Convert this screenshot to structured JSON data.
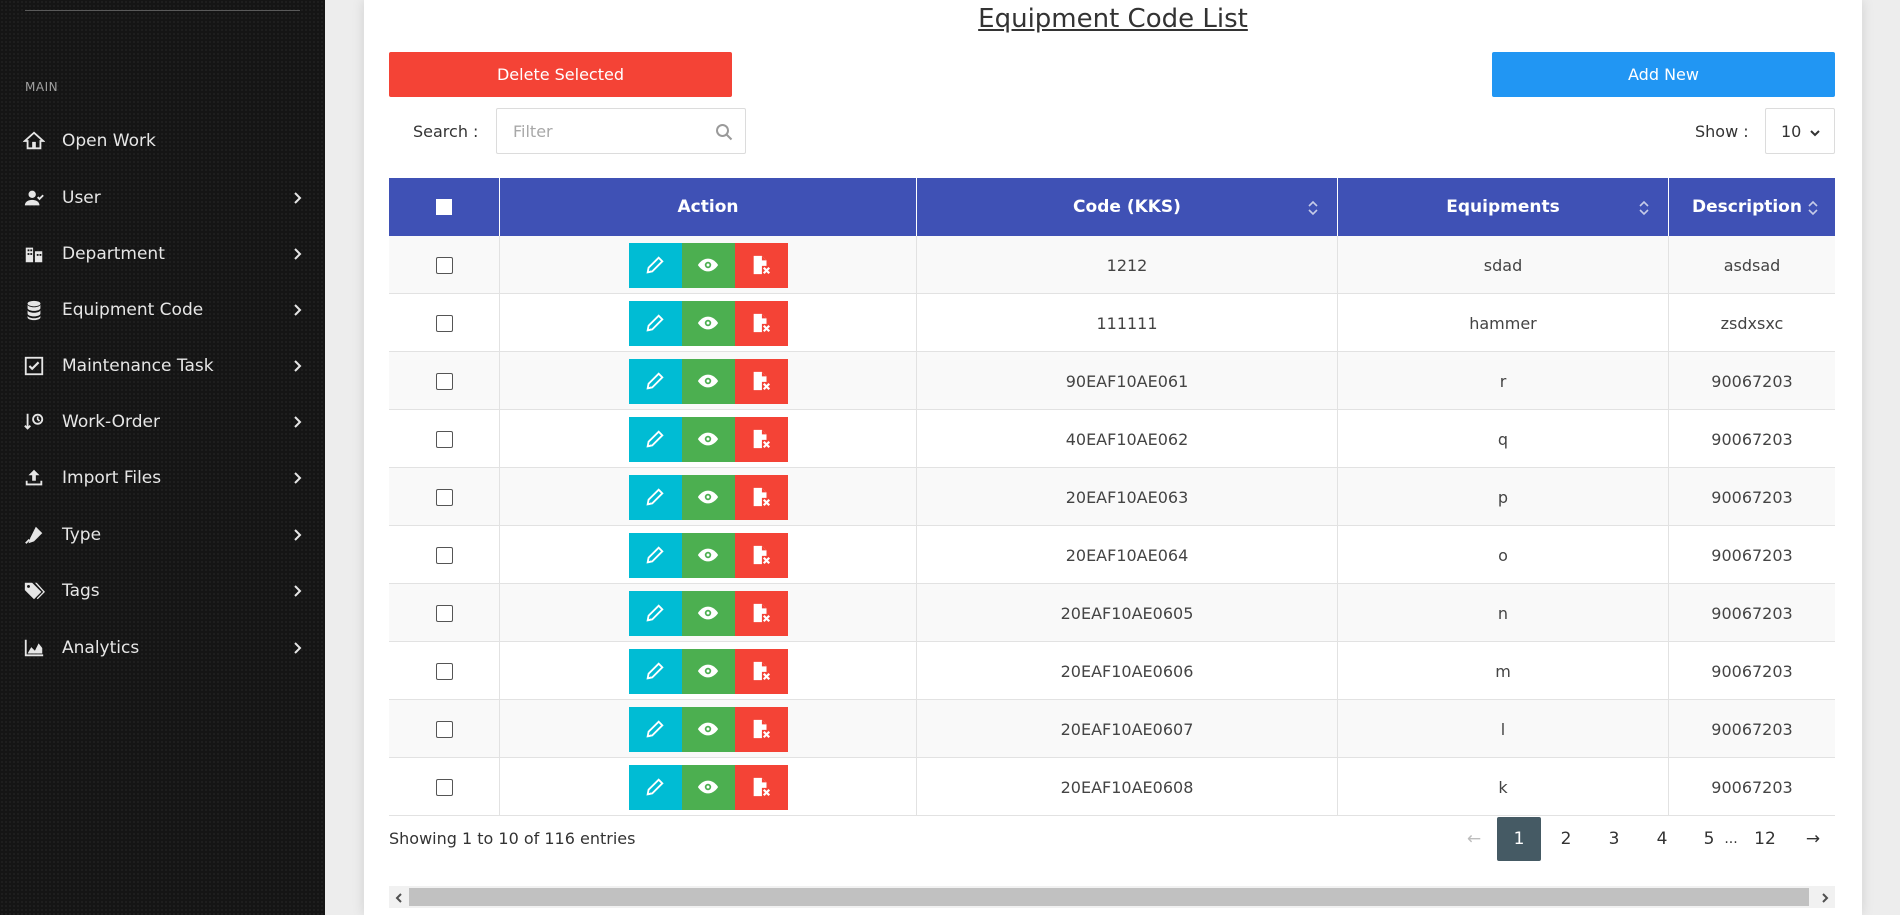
{
  "sidebar": {
    "section_label": "MAIN",
    "items": [
      {
        "label": "Open Work",
        "icon": "home-icon",
        "has_submenu": false
      },
      {
        "label": "User",
        "icon": "user-icon",
        "has_submenu": true
      },
      {
        "label": "Department",
        "icon": "building-icon",
        "has_submenu": true
      },
      {
        "label": "Equipment Code",
        "icon": "database-icon",
        "has_submenu": true
      },
      {
        "label": "Maintenance Task",
        "icon": "checkbox-icon",
        "has_submenu": true
      },
      {
        "label": "Work-Order",
        "icon": "sort-clock-icon",
        "has_submenu": true
      },
      {
        "label": "Import Files",
        "icon": "upload-icon",
        "has_submenu": true
      },
      {
        "label": "Type",
        "icon": "pen-icon",
        "has_submenu": true
      },
      {
        "label": "Tags",
        "icon": "tags-icon",
        "has_submenu": true
      },
      {
        "label": "Analytics",
        "icon": "chart-area-icon",
        "has_submenu": true
      }
    ]
  },
  "page": {
    "title": "Equipment Code List",
    "delete_selected_label": "Delete Selected",
    "add_new_label": "Add New",
    "search_label": "Search :",
    "search_placeholder": "Filter",
    "search_value": "",
    "show_label": "Show :",
    "show_value": "10"
  },
  "table": {
    "columns": [
      "Action",
      "Code (KKS)",
      "Equipments",
      "Description"
    ],
    "sortable_columns": [
      "Code (KKS)",
      "Equipments",
      "Description"
    ],
    "rows": [
      {
        "code": "1212",
        "equipment": "sdad",
        "description": "asdsad"
      },
      {
        "code": "111111",
        "equipment": "hammer",
        "description": "zsdxsxc"
      },
      {
        "code": "90EAF10AE061",
        "equipment": "r",
        "description": "90067203"
      },
      {
        "code": "40EAF10AE062",
        "equipment": "q",
        "description": "90067203"
      },
      {
        "code": "20EAF10AE063",
        "equipment": "p",
        "description": "90067203"
      },
      {
        "code": "20EAF10AE064",
        "equipment": "o",
        "description": "90067203"
      },
      {
        "code": "20EAF10AE0605",
        "equipment": "n",
        "description": "90067203"
      },
      {
        "code": "20EAF10AE0606",
        "equipment": "m",
        "description": "90067203"
      },
      {
        "code": "20EAF10AE0607",
        "equipment": "l",
        "description": "90067203"
      },
      {
        "code": "20EAF10AE0608",
        "equipment": "k",
        "description": "90067203"
      }
    ],
    "action_icons": [
      "pencil-icon",
      "eye-icon",
      "delete-file-icon"
    ]
  },
  "footer": {
    "info": "Showing 1 to 10 of 116 entries",
    "pagination": {
      "prev": "←",
      "pages": [
        "1",
        "2",
        "3",
        "4",
        "5"
      ],
      "ellipsis": "...",
      "last": "12",
      "next": "→",
      "active": "1"
    }
  },
  "colors": {
    "sidebar_bg": "#151515",
    "header_bg": "#3f51b5",
    "delete": "#f44336",
    "add": "#2196f3",
    "edit": "#00bcd4",
    "view": "#4caf50",
    "page_active": "#455a64"
  }
}
